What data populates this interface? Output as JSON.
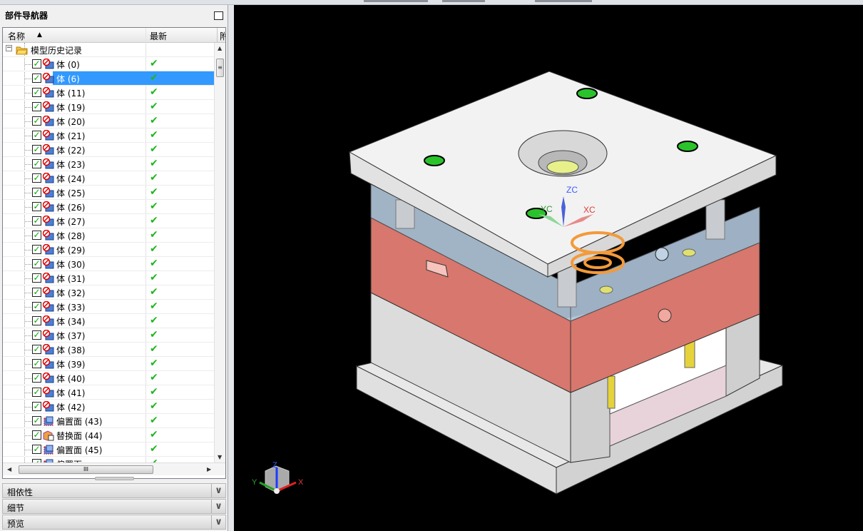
{
  "navigator": {
    "title": "部件导航器",
    "columns": {
      "name": "名称",
      "latest": "最新",
      "extra": "附"
    },
    "root": "模型历史记录",
    "items": [
      {
        "label": "体 (0)",
        "type": "body"
      },
      {
        "label": "体 (6)",
        "type": "body",
        "selected": true
      },
      {
        "label": "体 (11)",
        "type": "body"
      },
      {
        "label": "体 (19)",
        "type": "body"
      },
      {
        "label": "体 (20)",
        "type": "body"
      },
      {
        "label": "体 (21)",
        "type": "body"
      },
      {
        "label": "体 (22)",
        "type": "body"
      },
      {
        "label": "体 (23)",
        "type": "body"
      },
      {
        "label": "体 (24)",
        "type": "body"
      },
      {
        "label": "体 (25)",
        "type": "body"
      },
      {
        "label": "体 (26)",
        "type": "body"
      },
      {
        "label": "体 (27)",
        "type": "body"
      },
      {
        "label": "体 (28)",
        "type": "body"
      },
      {
        "label": "体 (29)",
        "type": "body"
      },
      {
        "label": "体 (30)",
        "type": "body"
      },
      {
        "label": "体 (31)",
        "type": "body"
      },
      {
        "label": "体 (32)",
        "type": "body"
      },
      {
        "label": "体 (33)",
        "type": "body"
      },
      {
        "label": "体 (34)",
        "type": "body"
      },
      {
        "label": "体 (37)",
        "type": "body"
      },
      {
        "label": "体 (38)",
        "type": "body"
      },
      {
        "label": "体 (39)",
        "type": "body"
      },
      {
        "label": "体 (40)",
        "type": "body"
      },
      {
        "label": "体 (41)",
        "type": "body"
      },
      {
        "label": "体 (42)",
        "type": "body"
      },
      {
        "label": "偏置面 (43)",
        "type": "offset"
      },
      {
        "label": "替换面 (44)",
        "type": "replace"
      },
      {
        "label": "偏置面 (45)",
        "type": "offset"
      },
      {
        "label": "偏置面",
        "type": "offset"
      }
    ],
    "sections": [
      "相依性",
      "细节",
      "预览"
    ]
  },
  "viewport": {
    "wcs_labels": {
      "x": "XC",
      "y": "YC",
      "z": "ZC"
    },
    "triad_labels": {
      "x": "X",
      "y": "Y",
      "z": "Z"
    },
    "colors": {
      "background": "#000000",
      "plate": "#f0f0f0",
      "red_plate": "#d97a6f",
      "transparent": "#b9cde0",
      "highlight": "#f39a3a"
    }
  }
}
